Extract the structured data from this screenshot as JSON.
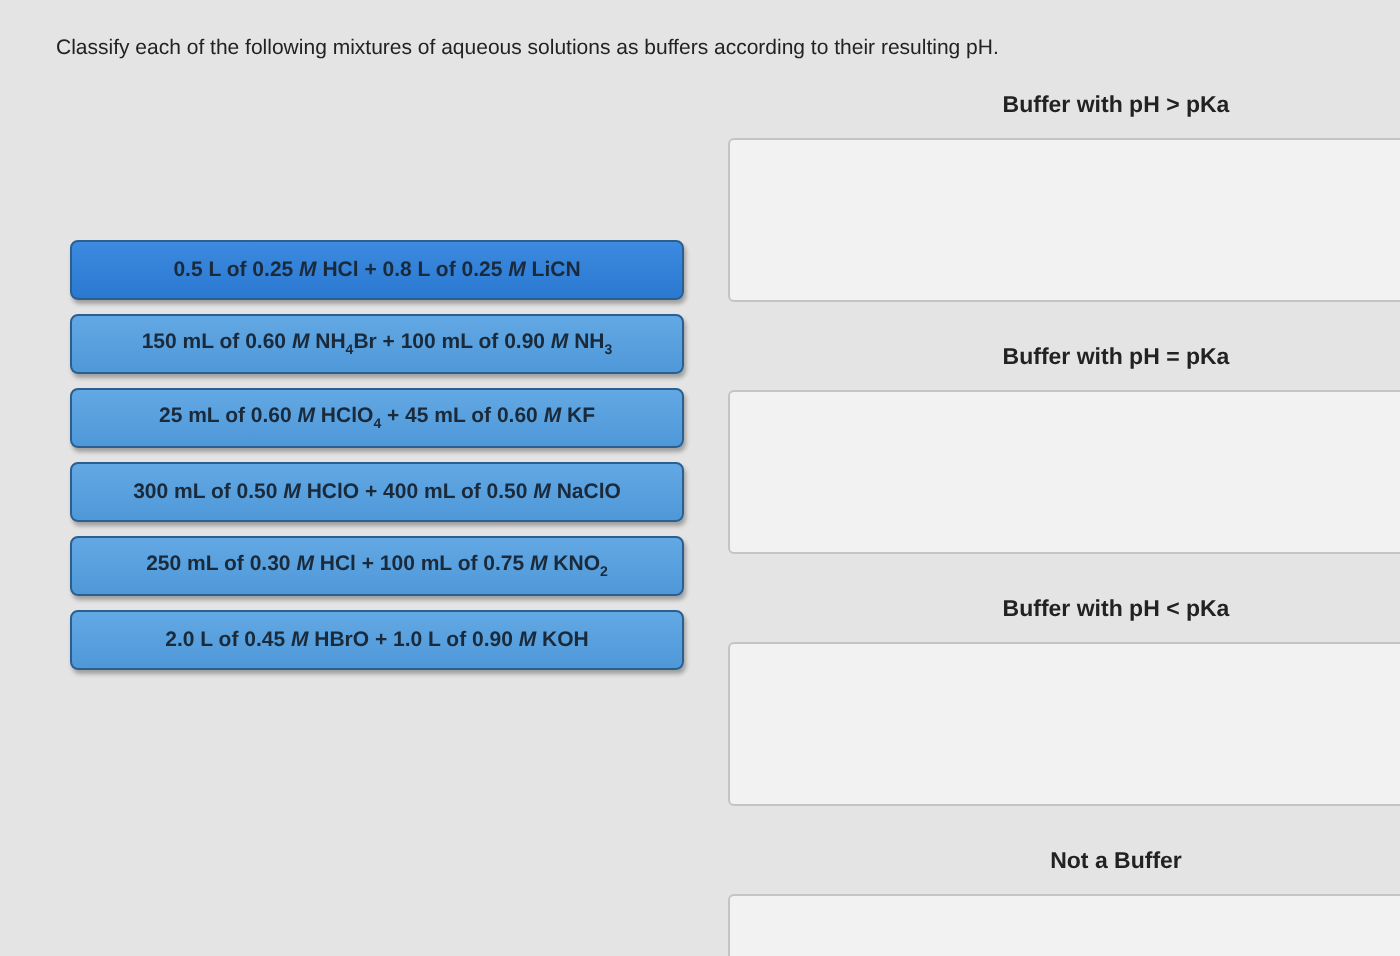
{
  "instruction": "Classify each of the following mixtures of aqueous solutions as buffers according to their resulting pH.",
  "mixtures": [
    {
      "label": "0.5 L of 0.25 *M* HCl + 0.8 L of 0.25 *M* LiCN",
      "selected": true
    },
    {
      "label": "150 mL of 0.60 *M* NH$_{4}$Br + 100 mL of 0.90 *M* NH$_{3}$",
      "selected": false
    },
    {
      "label": "25 mL of 0.60 *M* HClO$_{4}$ + 45 mL of 0.60 *M* KF",
      "selected": false
    },
    {
      "label": "300 mL of 0.50 *M* HClO + 400 mL of 0.50 *M* NaClO",
      "selected": false
    },
    {
      "label": "250 mL of 0.30 *M* HCl + 100 mL of 0.75 *M* KNO$_{2}$",
      "selected": false
    },
    {
      "label": "2.0 L of 0.45 *M* HBrO + 1.0 L of 0.90 *M* KOH",
      "selected": false
    }
  ],
  "categories": [
    {
      "label": "Buffer with pH > pKa"
    },
    {
      "label": "Buffer with pH = pKa"
    },
    {
      "label": "Buffer with pH < pKa"
    },
    {
      "label": "Not a Buffer"
    }
  ]
}
